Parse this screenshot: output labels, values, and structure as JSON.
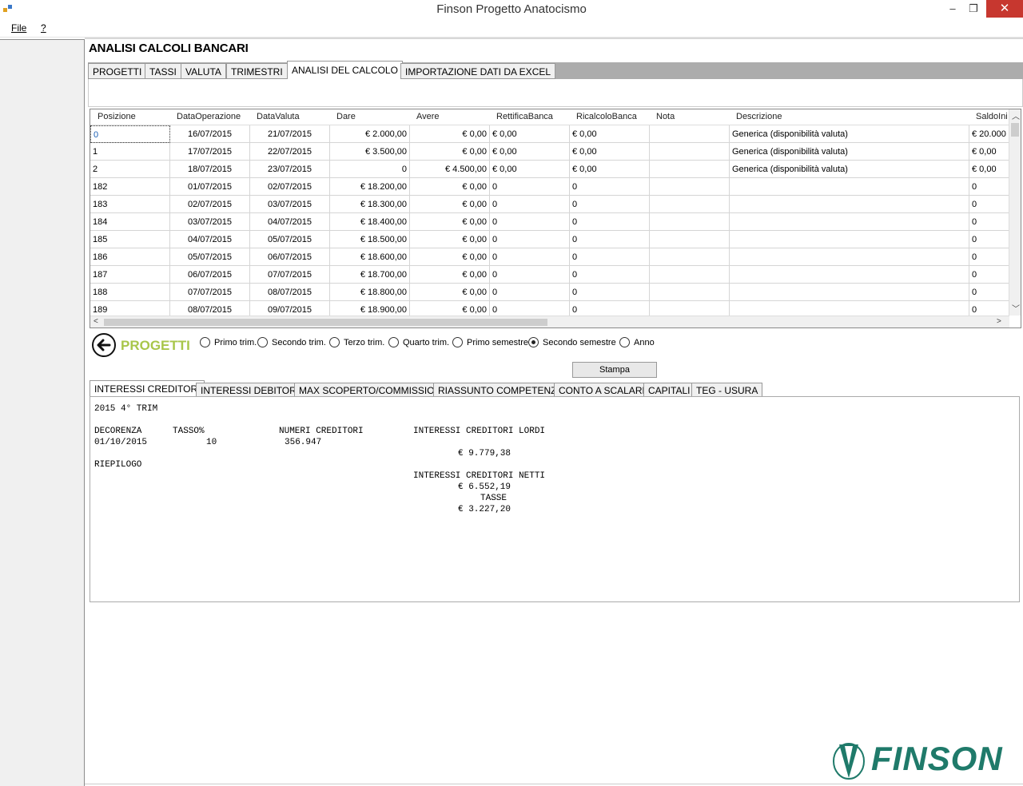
{
  "window": {
    "title": "Finson Progetto Anatocismo",
    "minimize": "–",
    "restore": "❐",
    "close": "✕"
  },
  "menu": {
    "file": "File",
    "help": "?"
  },
  "section_title": "ANALISI CALCOLI BANCARI",
  "main_tabs": [
    {
      "label": "PROGETTI"
    },
    {
      "label": "TASSI"
    },
    {
      "label": "VALUTA"
    },
    {
      "label": "TRIMESTRI"
    },
    {
      "label": "ANALISI DEL CALCOLO"
    },
    {
      "label": "IMPORTAZIONE DATI DA EXCEL"
    }
  ],
  "grid": {
    "headers": [
      "Posizione",
      "DataOperazione",
      "DataValuta",
      "Dare",
      "Avere",
      "RettificaBanca",
      "RicalcoloBanca",
      "Nota",
      "Descrizione",
      "SaldoIni"
    ],
    "rows": [
      [
        "0",
        "16/07/2015",
        "21/07/2015",
        "€ 2.000,00",
        "€ 0,00",
        "€ 0,00",
        "€ 0,00",
        "",
        "Generica (disponibilità valuta)",
        "€ 20.000"
      ],
      [
        "1",
        "17/07/2015",
        "22/07/2015",
        "€ 3.500,00",
        "€ 0,00",
        "€ 0,00",
        "€ 0,00",
        "",
        "Generica (disponibilità valuta)",
        "€ 0,00"
      ],
      [
        "2",
        "18/07/2015",
        "23/07/2015",
        "0",
        "€ 4.500,00",
        "€ 0,00",
        "€ 0,00",
        "",
        "Generica (disponibilità valuta)",
        "€ 0,00"
      ],
      [
        "182",
        "01/07/2015",
        "02/07/2015",
        "€ 18.200,00",
        "€ 0,00",
        "0",
        "0",
        "",
        "",
        "0"
      ],
      [
        "183",
        "02/07/2015",
        "03/07/2015",
        "€ 18.300,00",
        "€ 0,00",
        "0",
        "0",
        "",
        "",
        "0"
      ],
      [
        "184",
        "03/07/2015",
        "04/07/2015",
        "€ 18.400,00",
        "€ 0,00",
        "0",
        "0",
        "",
        "",
        "0"
      ],
      [
        "185",
        "04/07/2015",
        "05/07/2015",
        "€ 18.500,00",
        "€ 0,00",
        "0",
        "0",
        "",
        "",
        "0"
      ],
      [
        "186",
        "05/07/2015",
        "06/07/2015",
        "€ 18.600,00",
        "€ 0,00",
        "0",
        "0",
        "",
        "",
        "0"
      ],
      [
        "187",
        "06/07/2015",
        "07/07/2015",
        "€ 18.700,00",
        "€ 0,00",
        "0",
        "0",
        "",
        "",
        "0"
      ],
      [
        "188",
        "07/07/2015",
        "08/07/2015",
        "€ 18.800,00",
        "€ 0,00",
        "0",
        "0",
        "",
        "",
        "0"
      ],
      [
        "189",
        "08/07/2015",
        "09/07/2015",
        "€ 18.900,00",
        "€ 0,00",
        "0",
        "0",
        "",
        "",
        "0"
      ]
    ]
  },
  "progetti_label": "PROGETTI",
  "periods": [
    {
      "label": "Primo trim.",
      "checked": false
    },
    {
      "label": "Secondo trim.",
      "checked": false
    },
    {
      "label": "Terzo trim.",
      "checked": false
    },
    {
      "label": "Quarto trim.",
      "checked": false
    },
    {
      "label": "Primo semestre",
      "checked": false
    },
    {
      "label": "Secondo semestre",
      "checked": true
    },
    {
      "label": "Anno",
      "checked": false
    }
  ],
  "stampa_label": "Stampa",
  "sub_tabs": [
    {
      "label": "INTERESSI CREDITORI"
    },
    {
      "label": "INTERESSI DEBITORI"
    },
    {
      "label": "MAX SCOPERTO/COMMISSIONI"
    },
    {
      "label": "RIASSUNTO COMPETENZE"
    },
    {
      "label": "CONTO A SCALARE"
    },
    {
      "label": "CAPITALI"
    },
    {
      "label": "TEG - USURA"
    }
  ],
  "report": {
    "period": "2015 4° TRIM",
    "h_decorrenza": "DECORENZA",
    "h_tasso": "TASSO%",
    "h_numeri": "NUMERI CREDITORI",
    "h_lordi": "INTERESSI CREDITORI LORDI",
    "decorrenza": "01/10/2015",
    "tasso": "10",
    "numeri": "356.947",
    "lordi_value": "€ 9.779,38",
    "riepilogo": "RIEPILOGO",
    "h_netti": "INTERESSI CREDITORI NETTI",
    "netti_value": "€ 6.552,19",
    "h_tasse": "TASSE",
    "tasse_value": "€ 3.227,20"
  },
  "logo_text": "FINSON",
  "colors": {
    "accent_green": "#a8c64a",
    "logo_teal": "#1f7a6a",
    "close_red": "#c7372f"
  }
}
